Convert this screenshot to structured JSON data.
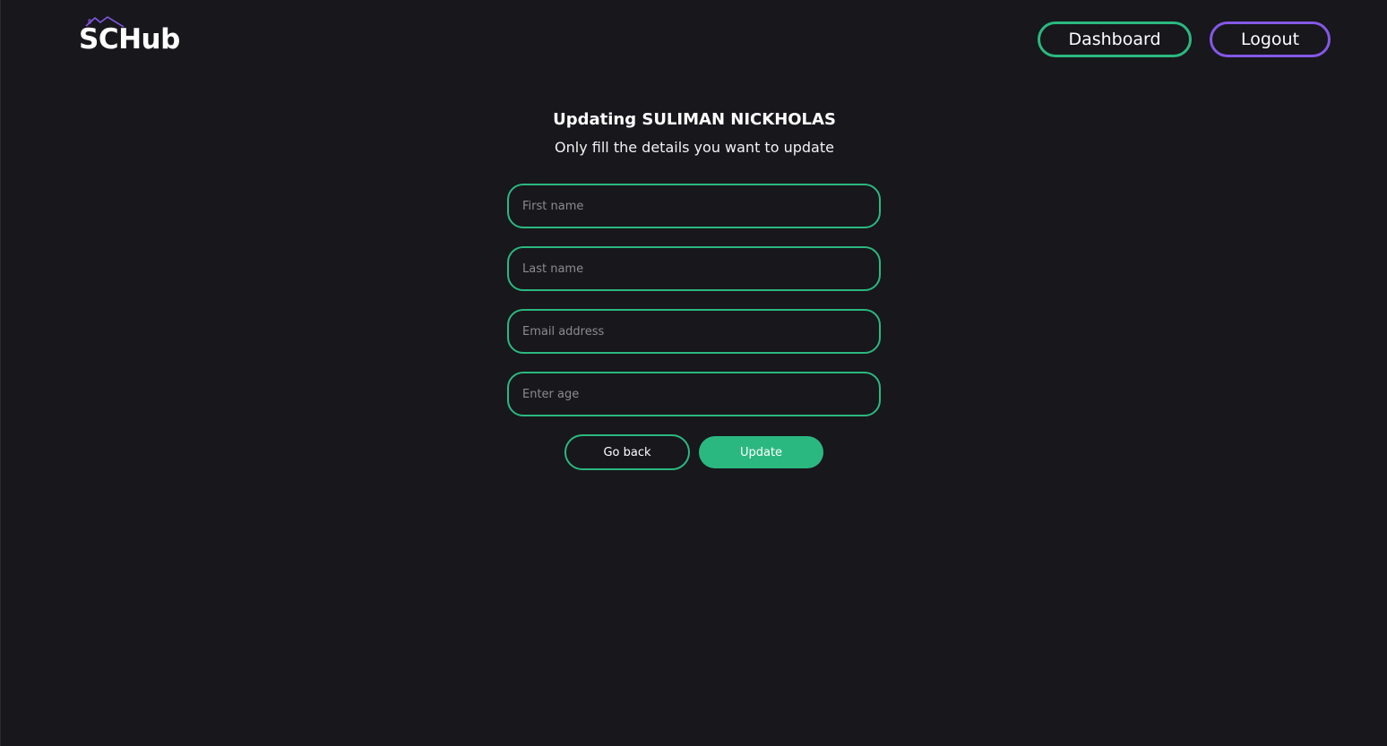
{
  "header": {
    "logo_text": "SCHub",
    "dashboard_label": "Dashboard",
    "logout_label": "Logout"
  },
  "form": {
    "title": "Updating SULIMAN NICKHOLAS",
    "subtitle": "Only fill the details you want to update",
    "fields": {
      "first_name": {
        "placeholder": "First name",
        "value": ""
      },
      "last_name": {
        "placeholder": "Last name",
        "value": ""
      },
      "email": {
        "placeholder": "Email address",
        "value": ""
      },
      "age": {
        "placeholder": "Enter age",
        "value": ""
      }
    },
    "go_back_label": "Go back",
    "update_label": "Update"
  },
  "colors": {
    "background": "#18171c",
    "accent_green": "#2bb880",
    "accent_purple": "#8458e6",
    "text": "#ffffff",
    "placeholder": "#8b8b90"
  },
  "icons": {
    "logo_roof": "house-roof-icon"
  }
}
